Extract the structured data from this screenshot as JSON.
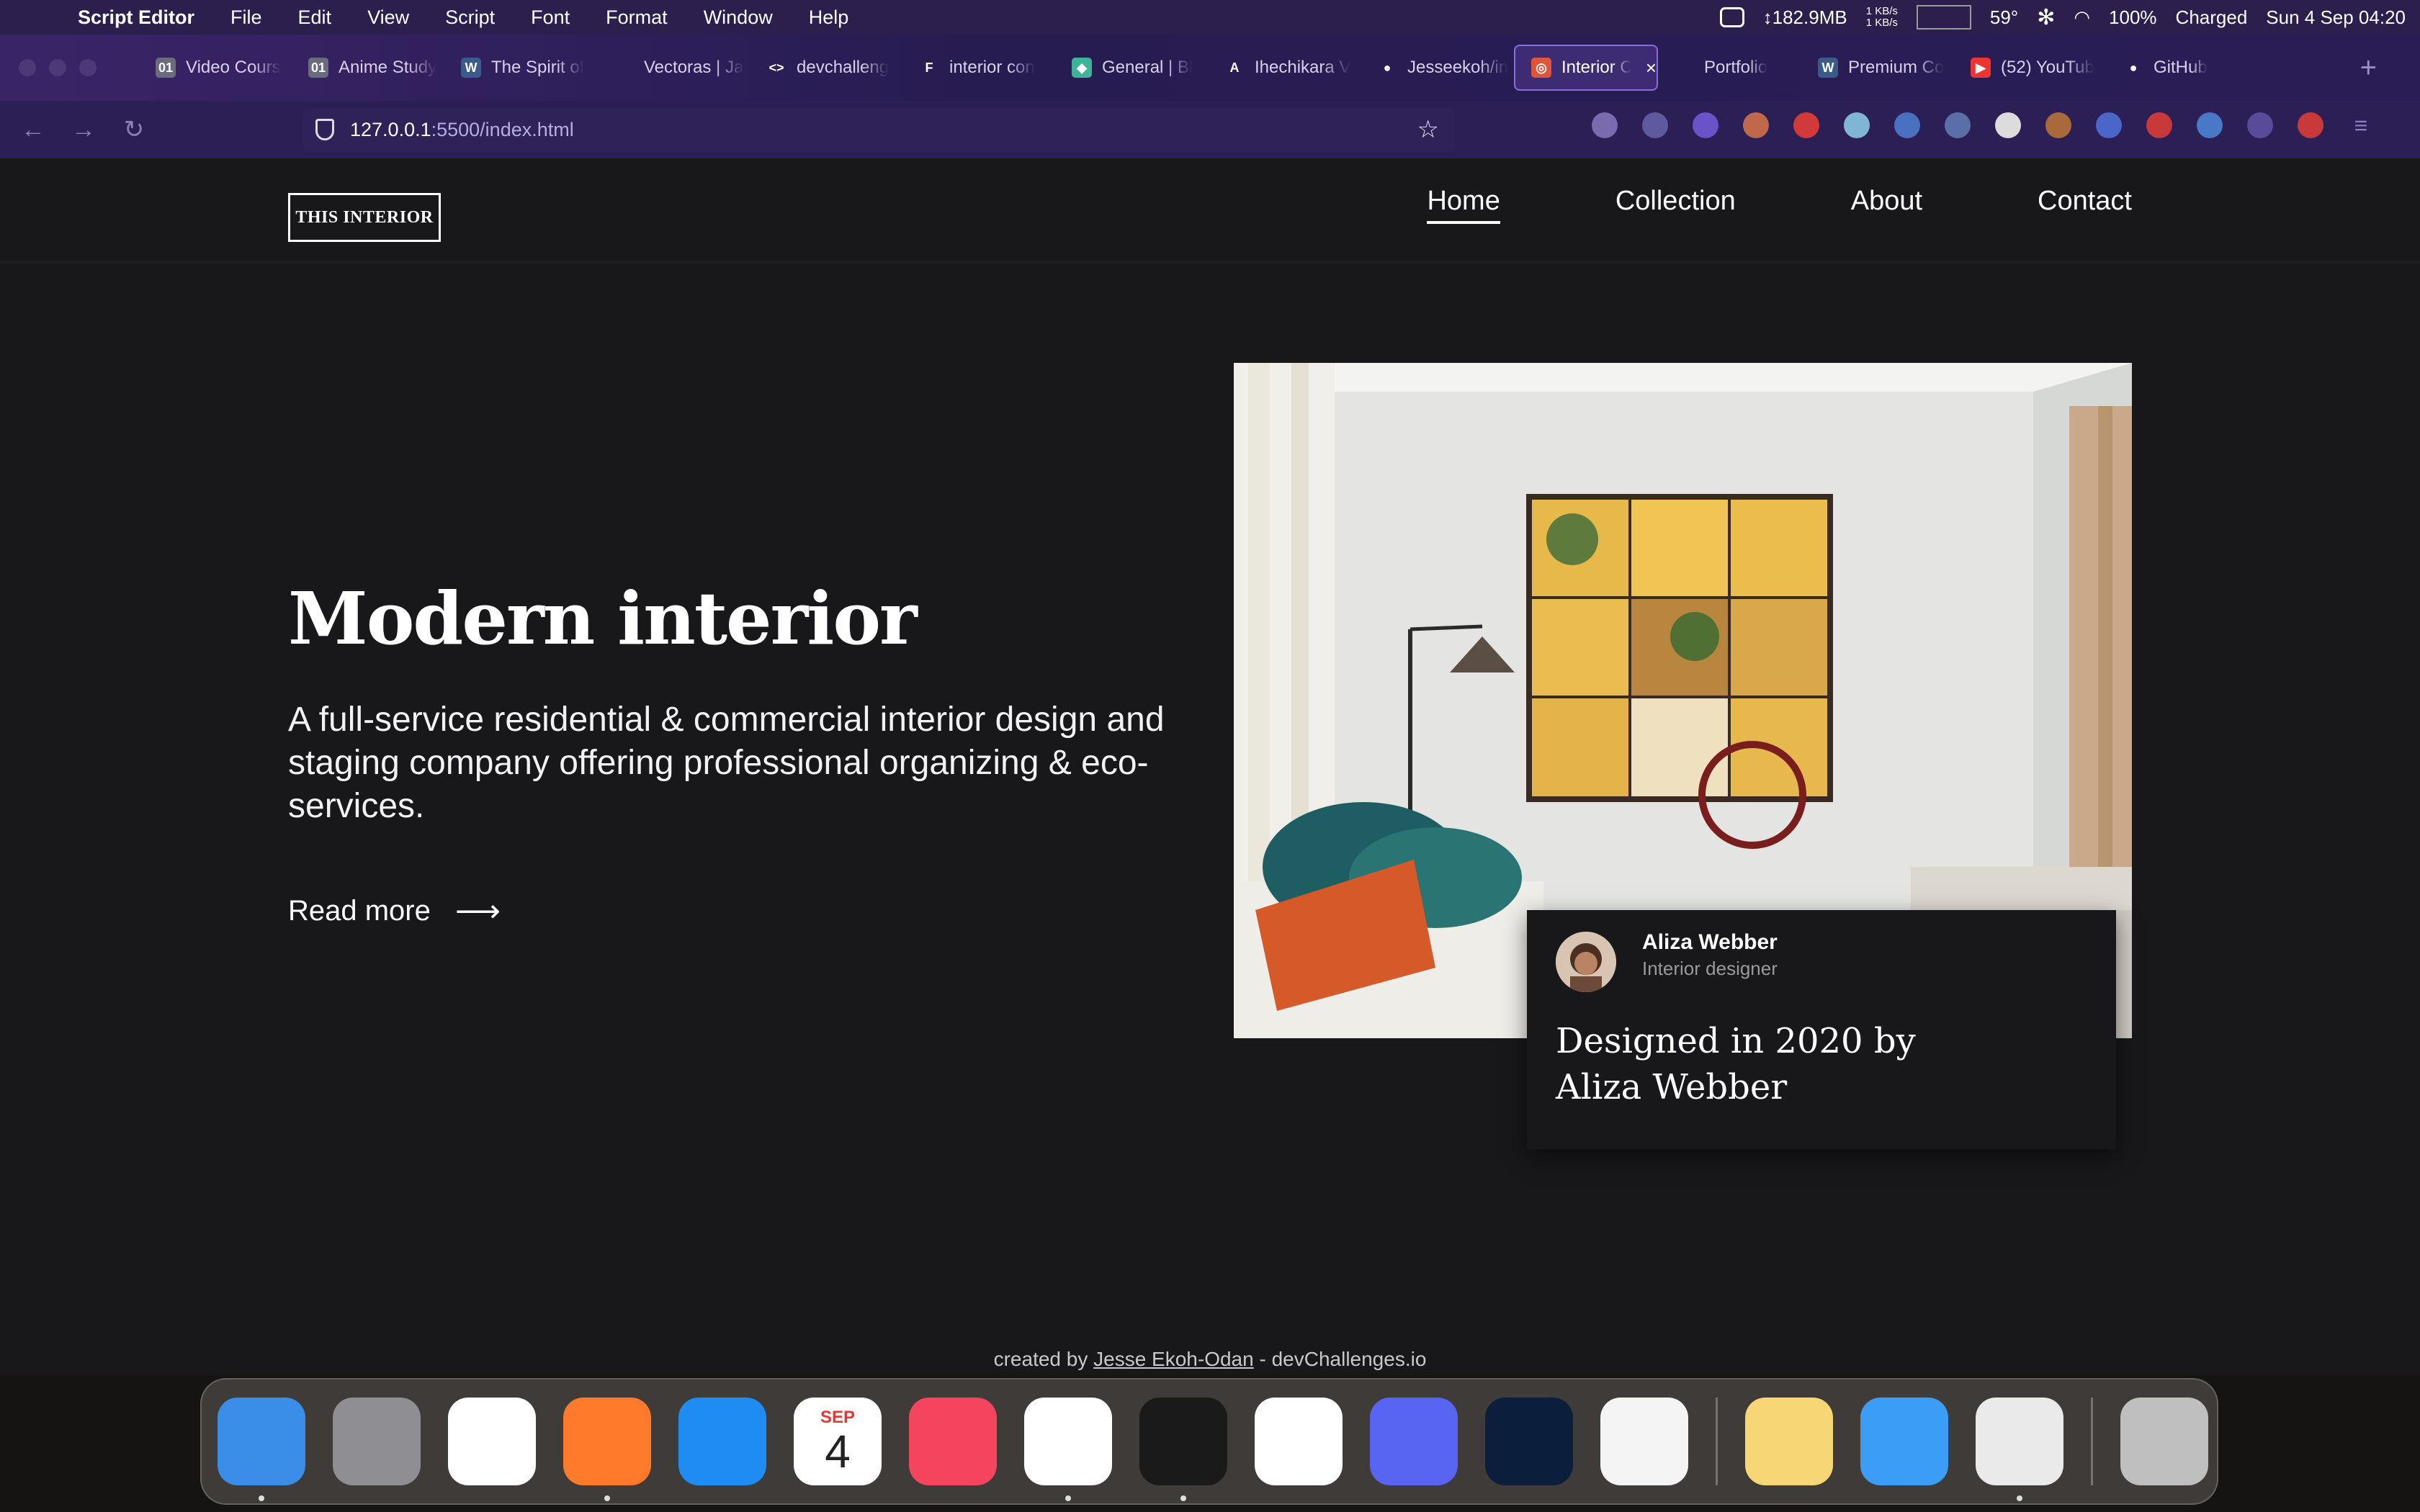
{
  "menubar": {
    "app_name": "Script Editor",
    "menus": [
      "File",
      "Edit",
      "View",
      "Script",
      "Font",
      "Format",
      "Window",
      "Help"
    ],
    "memory": "↕182.9MB",
    "net_up": "1 KB/s",
    "net_down": "1 KB/s",
    "temperature": "59°",
    "battery": "100%",
    "battery_status": "Charged",
    "datetime": "Sun 4 Sep  04:20"
  },
  "tabs": [
    {
      "label": "Video Cours",
      "icon_color": "#6b6b80",
      "icon_text": "01"
    },
    {
      "label": "Anime Study",
      "icon_color": "#6b6b80",
      "icon_text": "01"
    },
    {
      "label": "The Spirit of",
      "icon_color": "#3a5a8a",
      "icon_text": "W"
    },
    {
      "label": "Vectoras | JavaS",
      "icon_color": "transparent",
      "icon_text": ""
    },
    {
      "label": "devchalleng",
      "icon_color": "transparent",
      "icon_text": "<>"
    },
    {
      "label": "interior con",
      "icon_color": "transparent",
      "icon_text": "F"
    },
    {
      "label": "General | Bl",
      "icon_color": "#3fb39a",
      "icon_text": "◆"
    },
    {
      "label": "Ihechikara V",
      "icon_color": "transparent",
      "icon_text": "A"
    },
    {
      "label": "Jesseekoh/in",
      "icon_color": "transparent",
      "icon_text": "●"
    },
    {
      "label": "Interior C",
      "icon_color": "#e0553a",
      "icon_text": "◎",
      "active": true
    },
    {
      "label": "Portfolio",
      "icon_color": "transparent",
      "icon_text": ""
    },
    {
      "label": "Premium Co",
      "icon_color": "#3a5a8a",
      "icon_text": "W"
    },
    {
      "label": "(52) YouTub",
      "icon_color": "#e33",
      "icon_text": "▶"
    },
    {
      "label": "GitHub",
      "icon_color": "transparent",
      "icon_text": "●"
    }
  ],
  "address": {
    "host": "127.0.0.1",
    "rest": ":5500/index.html"
  },
  "site": {
    "logo": "THIS INTERIOR",
    "nav": [
      "Home",
      "Collection",
      "About",
      "Contact"
    ],
    "hero_title": "Modern interior",
    "hero_desc": "A full-service residential & commercial interior design and staging company offering professional organizing & eco-services.",
    "read_more": "Read more",
    "designer_name": "Aliza Webber",
    "designer_role": "Interior designer",
    "quote": "Designed in 2020 by Aliza Webber",
    "credit_prefix": "created by ",
    "credit_author": "Jesse Ekoh-Odan",
    "credit_suffix": " - devChallenges.io"
  },
  "dock": [
    {
      "name": "finder",
      "color": "#3a8ee8"
    },
    {
      "name": "launchpad",
      "color": "#8e8e93"
    },
    {
      "name": "chrome",
      "color": "#ffffff"
    },
    {
      "name": "firefox",
      "color": "#ff7a2a"
    },
    {
      "name": "app-store",
      "color": "#1e8cf2"
    },
    {
      "name": "calendar",
      "color": "#ffffff"
    },
    {
      "name": "music",
      "color": "#f5445d"
    },
    {
      "name": "vscode",
      "color": "#ffffff"
    },
    {
      "name": "terminal",
      "color": "#1a1a1a"
    },
    {
      "name": "pockity",
      "color": "#ffffff"
    },
    {
      "name": "discord",
      "color": "#5865f2"
    },
    {
      "name": "photoshop",
      "color": "#0b1e3b"
    },
    {
      "name": "clip-studio",
      "color": "#f4f4f4"
    },
    {
      "name": "notes",
      "color": "#f7d775"
    },
    {
      "name": "mail",
      "color": "#3b9df5"
    },
    {
      "name": "script-editor",
      "color": "#eaeaea"
    },
    {
      "name": "trash",
      "color": "#bfbfbf"
    }
  ],
  "calendar_icon": {
    "month": "SEP",
    "day": "4"
  }
}
